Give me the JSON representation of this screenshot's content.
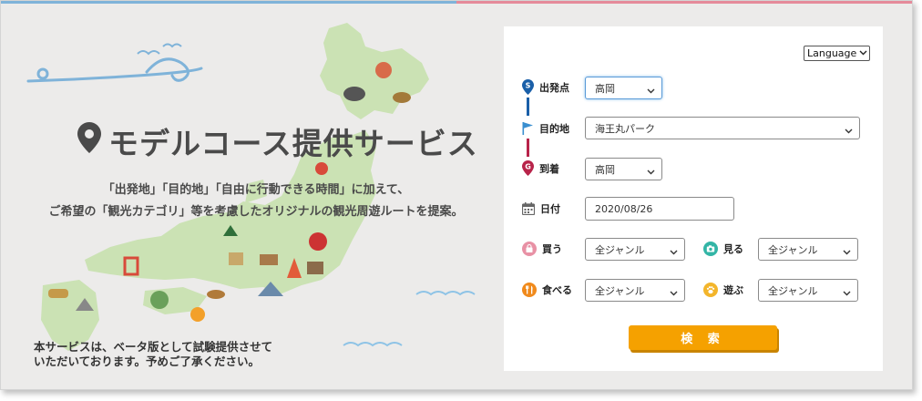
{
  "hero": {
    "title": "モデルコース提供サービス",
    "desc_line1": "「出発地」「目的地」「自由に行動できる時間」に加えて、",
    "desc_line2": "ご希望の「観光カテゴリ」等を考慮したオリジナルの観光周遊ルートを提案。",
    "notice_line1": "本サービスは、ベータ版として試験提供させて",
    "notice_line2": "いただいております。予めご了承ください。"
  },
  "language": {
    "label": "Language"
  },
  "form": {
    "departure": {
      "label": "出発点",
      "badge": "S",
      "value": "高岡"
    },
    "destination": {
      "label": "目的地",
      "value": "海王丸パーク"
    },
    "arrival": {
      "label": "到着",
      "badge": "G",
      "value": "高岡"
    },
    "date": {
      "label": "日付",
      "value": "2020/08/26"
    },
    "buy": {
      "label": "買う",
      "value": "全ジャンル"
    },
    "see": {
      "label": "見る",
      "value": "全ジャンル"
    },
    "eat": {
      "label": "食べる",
      "value": "全ジャンル"
    },
    "play": {
      "label": "遊ぶ",
      "value": "全ジャンル"
    },
    "search_label": "検 索"
  },
  "colors": {
    "start_blue": "#1a5fa8",
    "goal_red": "#b8244a",
    "button_orange": "#f5a100",
    "buy_pink": "#e891a5",
    "see_teal": "#33b5a6",
    "eat_orange": "#f08a1c",
    "play_yellow": "#f3b52b"
  },
  "icons": {
    "title": "map-pin-icon",
    "destination": "flag-icon",
    "date": "calendar-icon",
    "buy": "shopping-bag-icon",
    "see": "camera-icon",
    "eat": "fork-knife-icon",
    "play": "paw-icon"
  }
}
